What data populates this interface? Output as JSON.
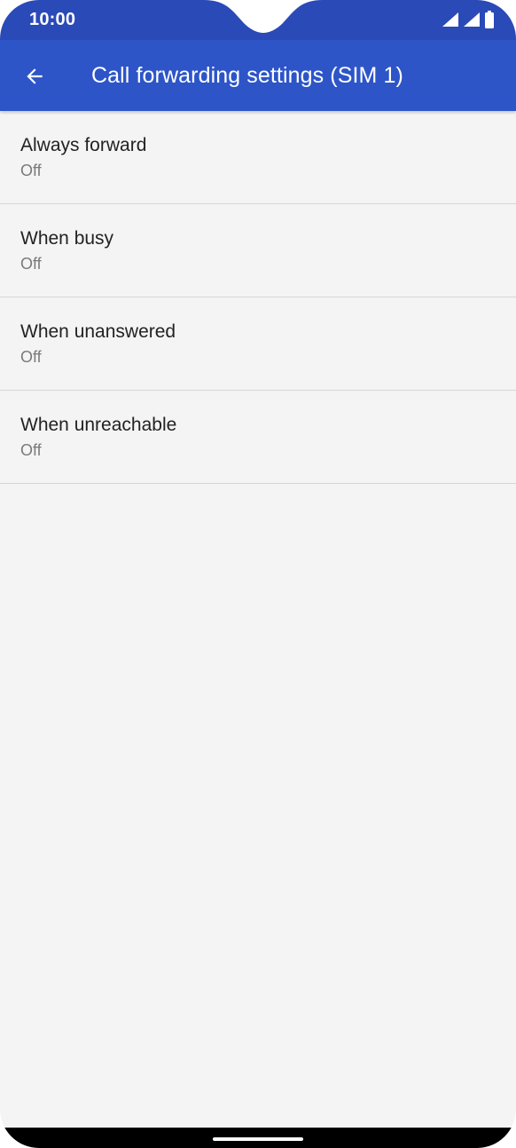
{
  "status_bar": {
    "time": "10:00",
    "icons": [
      "signal-icon",
      "signal-icon",
      "battery-icon"
    ]
  },
  "app_bar": {
    "back_icon": "arrow-left-icon",
    "title": "Call forwarding settings (SIM 1)"
  },
  "settings": [
    {
      "title": "Always forward",
      "summary": "Off"
    },
    {
      "title": "When busy",
      "summary": "Off"
    },
    {
      "title": "When unanswered",
      "summary": "Off"
    },
    {
      "title": "When unreachable",
      "summary": "Off"
    }
  ],
  "colors": {
    "status_bar": "#2a4ab8",
    "app_bar": "#2d55c8",
    "background": "#f4f4f4"
  }
}
